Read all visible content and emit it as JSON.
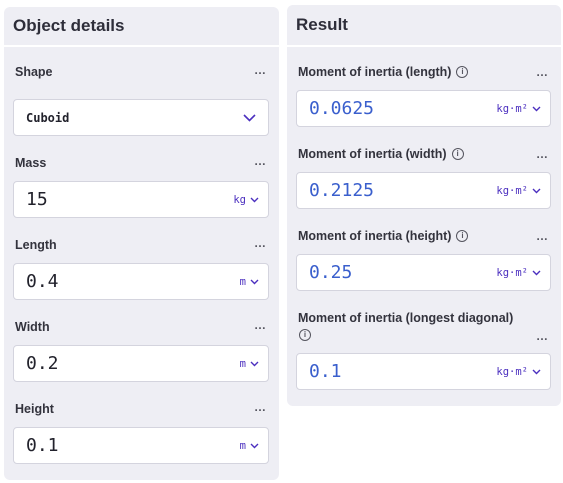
{
  "object_details": {
    "title": "Object details",
    "more_label": "…",
    "shape": {
      "label": "Shape",
      "value": "Cuboid"
    },
    "mass": {
      "label": "Mass",
      "value": "15",
      "unit": "kg"
    },
    "length": {
      "label": "Length",
      "value": "0.4",
      "unit": "m"
    },
    "width": {
      "label": "Width",
      "value": "0.2",
      "unit": "m"
    },
    "height": {
      "label": "Height",
      "value": "0.1",
      "unit": "m"
    }
  },
  "result": {
    "title": "Result",
    "more_label": "…",
    "info_glyph": "i",
    "moment_length": {
      "label": "Moment of inertia (length)",
      "value": "0.0625",
      "unit": "kg·m²"
    },
    "moment_width": {
      "label": "Moment of inertia (width)",
      "value": "0.2125",
      "unit": "kg·m²"
    },
    "moment_height": {
      "label": "Moment of inertia (height)",
      "value": "0.25",
      "unit": "kg·m²"
    },
    "moment_diagonal": {
      "label": "Moment of inertia (longest diagonal)",
      "value": "0.1",
      "unit": "kg·m²"
    }
  },
  "colors": {
    "panel_bg": "#eeeef4",
    "unit_accent": "#4b2fbf",
    "result_value": "#3a5fcd"
  }
}
